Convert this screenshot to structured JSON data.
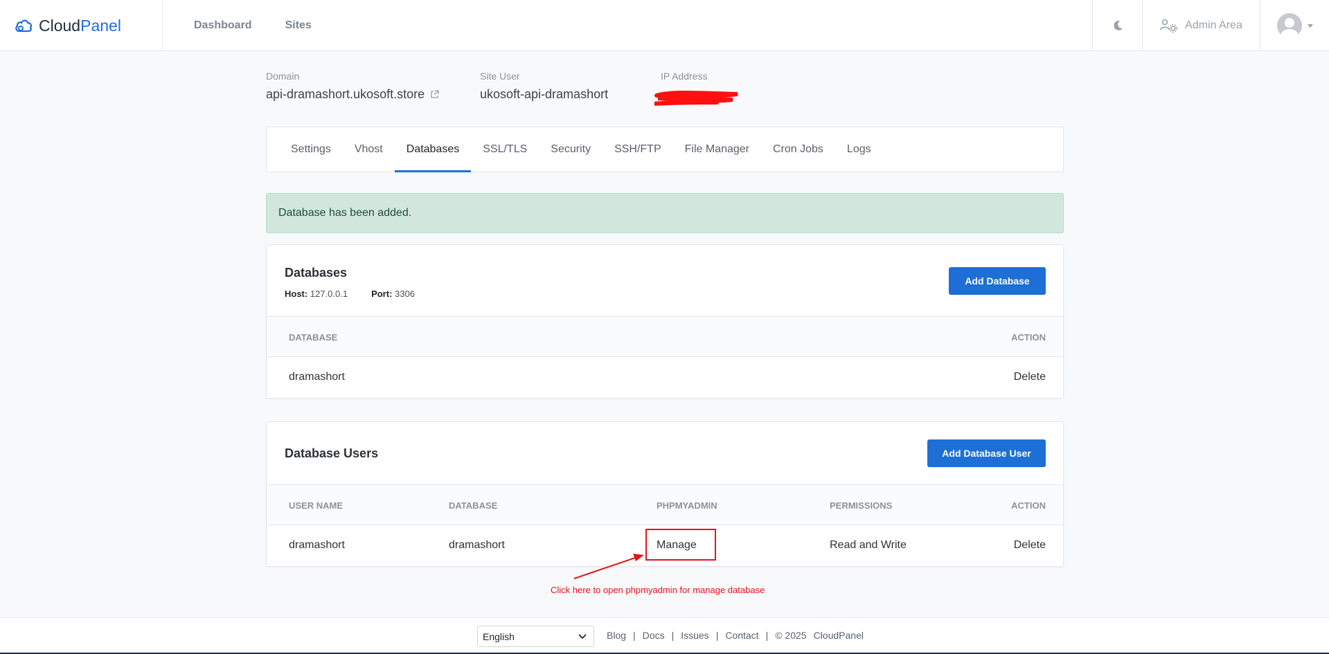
{
  "header": {
    "logo_cloud": "Cloud",
    "logo_panel": "Panel",
    "nav": [
      "Dashboard",
      "Sites"
    ],
    "admin_area": "Admin Area"
  },
  "site_info": {
    "domain_label": "Domain",
    "domain_value": "api-dramashort.ukosoft.store",
    "site_user_label": "Site User",
    "site_user_value": "ukosoft-api-dramashort",
    "ip_label": "IP Address"
  },
  "tabs": [
    "Settings",
    "Vhost",
    "Databases",
    "SSL/TLS",
    "Security",
    "SSH/FTP",
    "File Manager",
    "Cron Jobs",
    "Logs"
  ],
  "active_tab": "Databases",
  "alert": "Database has been added.",
  "databases_card": {
    "title": "Databases",
    "host_label": "Host:",
    "host_value": "127.0.0.1",
    "port_label": "Port:",
    "port_value": "3306",
    "add_button": "Add Database",
    "columns": [
      "DATABASE",
      "ACTION"
    ],
    "rows": [
      {
        "database": "dramashort",
        "action": "Delete"
      }
    ]
  },
  "users_card": {
    "title": "Database Users",
    "add_button": "Add Database User",
    "columns": [
      "USER NAME",
      "DATABASE",
      "PHPMYADMIN",
      "PERMISSIONS",
      "ACTION"
    ],
    "rows": [
      {
        "user": "dramashort",
        "database": "dramashort",
        "phpmyadmin": "Manage",
        "permissions": "Read and Write",
        "action": "Delete"
      }
    ]
  },
  "annotation": "Click here to open phpmyadmin for manage database",
  "footer": {
    "language": "English",
    "links": [
      "Blog",
      "Docs",
      "Issues",
      "Contact"
    ],
    "copyright": "© 2025",
    "brand": "CloudPanel"
  },
  "colors": {
    "accent": "#1d6fd6",
    "alert_bg": "#d1e7dd",
    "annotation": "#e8121b"
  }
}
